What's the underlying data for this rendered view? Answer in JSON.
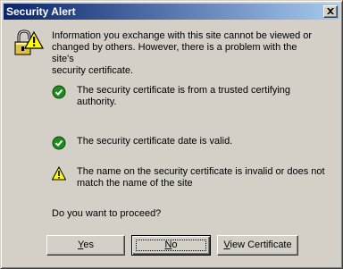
{
  "window": {
    "title": "Security Alert",
    "close_icon": "close-icon"
  },
  "intro_text": "Information you exchange with this site cannot be viewed or\nchanged by others. However, there is a problem with the site's\nsecurity certificate.",
  "checks": [
    {
      "status": "ok",
      "icon": "green-check-icon",
      "text": "The security certificate is from a trusted certifying authority."
    },
    {
      "status": "ok",
      "icon": "green-check-icon",
      "text": "The security certificate date is valid."
    },
    {
      "status": "warning",
      "icon": "warning-icon",
      "text": "The name on the security certificate is invalid or does not\nmatch the name of the site"
    }
  ],
  "question": "Do you want to proceed?",
  "buttons": {
    "yes": {
      "mnemonic": "Y",
      "rest": "es"
    },
    "no": {
      "mnemonic": "N",
      "rest": "o"
    },
    "view_certificate": {
      "mnemonic": "V",
      "rest": "iew Certificate"
    }
  },
  "colors": {
    "title_gradient_start": "#0a246a",
    "title_gradient_end": "#a6caf0",
    "ok_green": "#1f8a1f",
    "warning_yellow": "#ffff00",
    "face": "#d4d0c8"
  }
}
